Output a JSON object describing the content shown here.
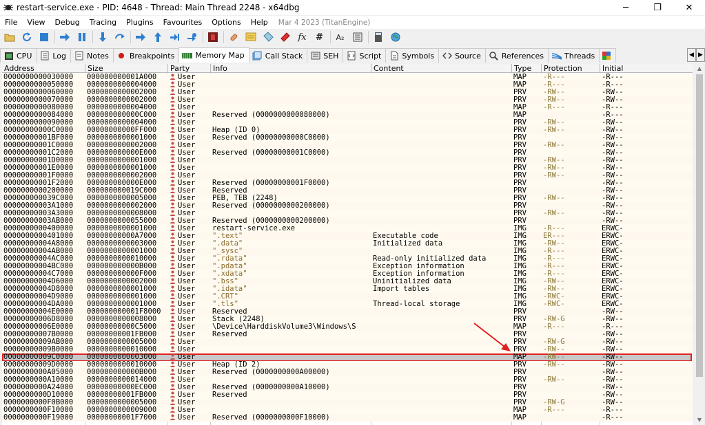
{
  "window": {
    "title": "restart-service.exe - PID: 4648 - Thread: Main Thread 2248 - x64dbg",
    "minimize": "─",
    "maximize": "❐",
    "close": "✕"
  },
  "menu": {
    "items": [
      "File",
      "View",
      "Debug",
      "Tracing",
      "Plugins",
      "Favourites",
      "Options",
      "Help"
    ],
    "date": "Mar 4 2023 (TitanEngine)"
  },
  "toolbar": {
    "icons": [
      "open-icon",
      "restart-icon",
      "stop-icon",
      "run-icon",
      "pause-icon",
      "step-into-icon",
      "step-over-icon",
      "trace-into-icon",
      "trace-over-icon",
      "execute-till-return-icon",
      "run-to-user-code-icon",
      "scylla-icon",
      "patch-icon",
      "comment-icon",
      "label-icon",
      "bookmark-icon",
      "function-icon",
      "hash-icon",
      "font-icon",
      "strings-icon",
      "calculator-icon",
      "globe-icon"
    ],
    "font_label": "A₂",
    "fx_label": "fx",
    "hash_label": "#"
  },
  "tabs": [
    {
      "label": "CPU",
      "icon": "cpu-icon"
    },
    {
      "label": "Log",
      "icon": "log-icon"
    },
    {
      "label": "Notes",
      "icon": "notes-icon"
    },
    {
      "label": "Breakpoints",
      "icon": "breakpoint-icon"
    },
    {
      "label": "Memory Map",
      "icon": "memory-map-icon"
    },
    {
      "label": "Call Stack",
      "icon": "call-stack-icon"
    },
    {
      "label": "SEH",
      "icon": "seh-icon"
    },
    {
      "label": "Script",
      "icon": "script-icon"
    },
    {
      "label": "Symbols",
      "icon": "symbols-icon"
    },
    {
      "label": "Source",
      "icon": "source-icon"
    },
    {
      "label": "References",
      "icon": "references-icon"
    },
    {
      "label": "Threads",
      "icon": "threads-icon"
    }
  ],
  "active_tab": "Memory Map",
  "columns": [
    "Address",
    "Size",
    "Party",
    "Info",
    "Content",
    "Type",
    "Protection",
    "Initial"
  ],
  "rows": [
    [
      "0000000000030000",
      "000000000001A000",
      "User",
      "",
      "",
      "MAP",
      "-R---",
      "-R---"
    ],
    [
      "0000000000050000",
      "0000000000004000",
      "User",
      "",
      "",
      "MAP",
      "-R---",
      "-R---"
    ],
    [
      "0000000000060000",
      "0000000000002000",
      "User",
      "",
      "",
      "PRV",
      "-RW--",
      "-RW--"
    ],
    [
      "0000000000070000",
      "0000000000002000",
      "User",
      "",
      "",
      "PRV",
      "-RW--",
      "-RW--"
    ],
    [
      "0000000000080000",
      "0000000000004000",
      "User",
      "",
      "",
      "MAP",
      "-R---",
      "-R---"
    ],
    [
      "0000000000084000",
      "000000000000C000",
      "User",
      "Reserved (0000000000080000)",
      "",
      "MAP",
      "",
      "-R---"
    ],
    [
      "0000000000090000",
      "0000000000004000",
      "User",
      "",
      "",
      "PRV",
      "-RW--",
      "-RW--"
    ],
    [
      "00000000000C0000",
      "00000000000FF000",
      "User",
      "Heap (ID 0)",
      "",
      "PRV",
      "-RW--",
      "-RW--"
    ],
    [
      "00000000001BF000",
      "0000000000001000",
      "User",
      "Reserved (00000000000C0000)",
      "",
      "PRV",
      "",
      "-RW--"
    ],
    [
      "00000000001C0000",
      "0000000000002000",
      "User",
      "",
      "",
      "PRV",
      "-RW--",
      "-RW--"
    ],
    [
      "00000000001C2000",
      "000000000000E000",
      "User",
      "Reserved (00000000001C0000)",
      "",
      "PRV",
      "",
      "-RW--"
    ],
    [
      "00000000001D0000",
      "0000000000001000",
      "User",
      "",
      "",
      "PRV",
      "-RW--",
      "-RW--"
    ],
    [
      "00000000001E0000",
      "0000000000001000",
      "User",
      "",
      "",
      "PRV",
      "-RW--",
      "-RW--"
    ],
    [
      "00000000001F0000",
      "0000000000002000",
      "User",
      "",
      "",
      "PRV",
      "-RW--",
      "-RW--"
    ],
    [
      "00000000001F2000",
      "000000000000E000",
      "User",
      "Reserved (00000000001F0000)",
      "",
      "PRV",
      "",
      "-RW--"
    ],
    [
      "0000000000200000",
      "000000000019C000",
      "User",
      "Reserved",
      "",
      "PRV",
      "",
      "-RW--"
    ],
    [
      "000000000039C000",
      "0000000000005000",
      "User",
      "PEB, TEB (2248)",
      "",
      "PRV",
      "-RW--",
      "-RW--"
    ],
    [
      "00000000003A1000",
      "0000000000002000",
      "User",
      "Reserved (0000000000200000)",
      "",
      "PRV",
      "",
      "-RW--"
    ],
    [
      "00000000003A3000",
      "0000000000008000",
      "User",
      "",
      "",
      "PRV",
      "-RW--",
      "-RW--"
    ],
    [
      "00000000003AB000",
      "0000000000055000",
      "User",
      "Reserved (0000000000200000)",
      "",
      "PRV",
      "",
      "-RW--"
    ],
    [
      "0000000000400000",
      "0000000000001000",
      "User",
      "restart-service.exe",
      "",
      "IMG",
      "-R---",
      "ERWC-"
    ],
    [
      "0000000000401000",
      "00000000000A7000",
      "User",
      "\".text\"",
      "Executable code",
      "IMG",
      "ER---",
      "ERWC-"
    ],
    [
      "00000000004A8000",
      "0000000000003000",
      "User",
      "\".data\"",
      "Initialized data",
      "IMG",
      "-RW--",
      "ERWC-"
    ],
    [
      "00000000004AB000",
      "0000000000001000",
      "User",
      "\"_sysc\"",
      "",
      "IMG",
      "-R---",
      "ERWC-"
    ],
    [
      "00000000004AC000",
      "0000000000010000",
      "User",
      "\".rdata\"",
      "Read-only initialized data",
      "IMG",
      "-R---",
      "ERWC-"
    ],
    [
      "00000000004BC000",
      "000000000000B000",
      "User",
      "\".pdata\"",
      "Exception information",
      "IMG",
      "-R---",
      "ERWC-"
    ],
    [
      "00000000004C7000",
      "000000000000F000",
      "User",
      "\".xdata\"",
      "Exception information",
      "IMG",
      "-R---",
      "ERWC-"
    ],
    [
      "00000000004D6000",
      "0000000000002000",
      "User",
      "\".bss\"",
      "Uninitialized data",
      "IMG",
      "-RW--",
      "ERWC-"
    ],
    [
      "00000000004D8000",
      "0000000000001000",
      "User",
      "\".idata\"",
      "Import tables",
      "IMG",
      "-RW--",
      "ERWC-"
    ],
    [
      "00000000004D9000",
      "0000000000001000",
      "User",
      "\".CRT\"",
      "",
      "IMG",
      "-RWC-",
      "ERWC-"
    ],
    [
      "00000000004DA000",
      "0000000000001000",
      "User",
      "\".tls\"",
      "Thread-local storage",
      "IMG",
      "-RWC-",
      "ERWC-"
    ],
    [
      "00000000004E0000",
      "000000000001F8000",
      "User",
      "Reserved",
      "",
      "PRV",
      "",
      "-RW--"
    ],
    [
      "00000000006D8000",
      "0000000000008000",
      "User",
      "Stack (2248)",
      "",
      "PRV",
      "-RW-G",
      "-RW--"
    ],
    [
      "00000000006E0000",
      "00000000000C5000",
      "User",
      "\\Device\\HarddiskVolume3\\Windows\\S",
      "",
      "MAP",
      "-R---",
      "-R---"
    ],
    [
      "00000000007B0000",
      "00000000001FB000",
      "User",
      "Reserved",
      "",
      "PRV",
      "",
      "-RW--"
    ],
    [
      "00000000009AB000",
      "0000000000005000",
      "User",
      "",
      "",
      "PRV",
      "-RW-G",
      "-RW--"
    ],
    [
      "00000000009B0000",
      "0000000000010000",
      "User",
      "",
      "",
      "PRV",
      "-RW--",
      "-RW--"
    ],
    [
      "00000000009C0000",
      "0000000000003000",
      "User",
      "",
      "",
      "MAP",
      "-RW--",
      "-RW--"
    ],
    [
      "00000000009D0000",
      "0000000000010000",
      "User",
      "Heap (ID 2)",
      "",
      "PRV",
      "-RW--",
      "-RW--"
    ],
    [
      "0000000000A05000",
      "000000000000B000",
      "User",
      "Reserved (0000000000A00000)",
      "",
      "PRV",
      "",
      "-RW--"
    ],
    [
      "0000000000A10000",
      "0000000000014000",
      "User",
      "",
      "",
      "PRV",
      "-RW--",
      "-RW--"
    ],
    [
      "0000000000A24000",
      "00000000000EC000",
      "User",
      "Reserved (0000000000A10000)",
      "",
      "PRV",
      "",
      "-RW--"
    ],
    [
      "0000000000D10000",
      "00000000001FB000",
      "User",
      "Reserved",
      "",
      "PRV",
      "",
      "-RW--"
    ],
    [
      "0000000000F0B000",
      "0000000000005000",
      "User",
      "",
      "",
      "PRV",
      "-RW-G",
      "-RW--"
    ],
    [
      "0000000000F10000",
      "0000000000009000",
      "User",
      "",
      "",
      "MAP",
      "-R---",
      "-R---"
    ],
    [
      "0000000000F19000",
      "00000000001F7000",
      "User",
      "Reserved (0000000000F10000)",
      "",
      "MAP",
      "",
      "-R---"
    ]
  ],
  "highlighted_row": 37,
  "colors": {
    "highlight_border": "#e02020",
    "arrow": "#e02020",
    "row_bg": "#fffbf0"
  }
}
